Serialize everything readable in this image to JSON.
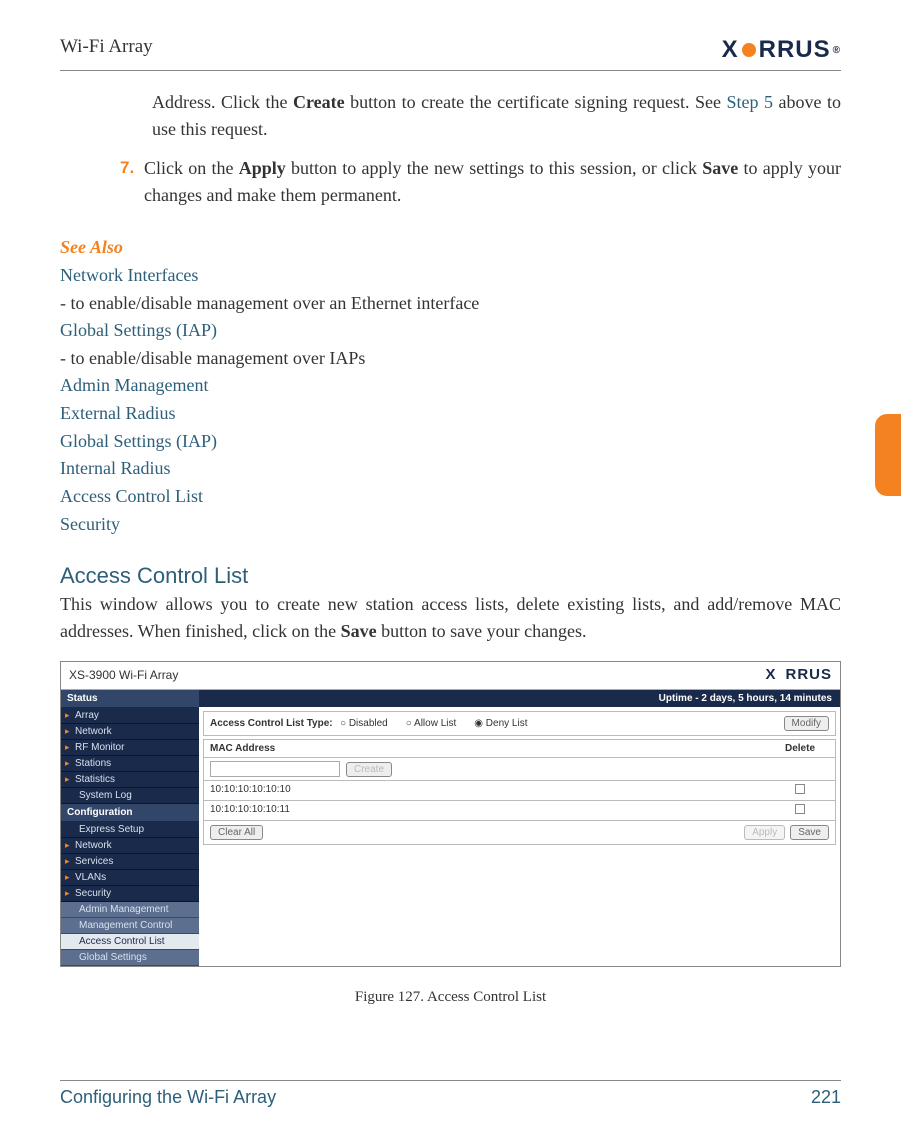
{
  "header": {
    "title": "Wi-Fi Array",
    "logo_text_before": "X",
    "logo_text_after": "RRUS",
    "logo_reg": "®"
  },
  "intro": {
    "line1a": "Address. Click the ",
    "create": "Create",
    "line1b": " button to create the certificate signing request. See ",
    "step5": "Step 5",
    "line1c": " above to use this request."
  },
  "step7": {
    "num": "7.",
    "a": "Click on the ",
    "apply": "Apply",
    "b": " button to apply the new settings to this session, or click ",
    "save": "Save",
    "c": " to apply your changes and make them permanent."
  },
  "see_also": {
    "heading": "See Also",
    "items": [
      {
        "link": "Network Interfaces",
        "rest": " - to enable/disable management over an Ethernet interface"
      },
      {
        "link": "Global Settings (IAP)",
        "rest": " - to enable/disable management over IAPs"
      },
      {
        "link": "Admin Management",
        "rest": ""
      },
      {
        "link": "External Radius",
        "rest": ""
      },
      {
        "link": "Global Settings (IAP)",
        "rest": ""
      },
      {
        "link": "Internal Radius",
        "rest": ""
      },
      {
        "link": "Access Control List",
        "rest": ""
      },
      {
        "link": "Security",
        "rest": ""
      }
    ]
  },
  "section": {
    "heading": "Access Control List",
    "para_a": "This window allows you to create new station access lists, delete existing lists, and add/remove MAC addresses. When finished, click on the ",
    "save": "Save",
    "para_b": " button to save your changes."
  },
  "figure": {
    "device": "XS-3900 Wi-Fi Array",
    "logo_before": "X",
    "logo_after": "RRUS",
    "uptime": "Uptime - 2 days, 5 hours, 14 minutes",
    "sidebar": {
      "status_head": "Status",
      "status_items": [
        "Array",
        "Network",
        "RF Monitor",
        "Stations",
        "Statistics"
      ],
      "status_sub": "System Log",
      "config_head": "Configuration",
      "config_sub1": "Express Setup",
      "config_items": [
        "Network",
        "Services",
        "VLANs",
        "Security"
      ],
      "sec_subs": [
        "Admin Management",
        "Management Control",
        "Access Control List",
        "Global Settings"
      ]
    },
    "panel": {
      "acl_label": "Access Control List Type:",
      "opt_disabled": "Disabled",
      "opt_allow": "Allow List",
      "opt_deny": "Deny List",
      "modify": "Modify",
      "mac_head": "MAC Address",
      "delete_head": "Delete",
      "create_btn": "Create",
      "rows": [
        "10:10:10:10:10:10",
        "10:10:10:10:10:11"
      ],
      "clear_all": "Clear All",
      "apply": "Apply",
      "save": "Save"
    },
    "caption": "Figure 127. Access Control List"
  },
  "footer": {
    "left": "Configuring the Wi-Fi Array",
    "right": "221"
  }
}
